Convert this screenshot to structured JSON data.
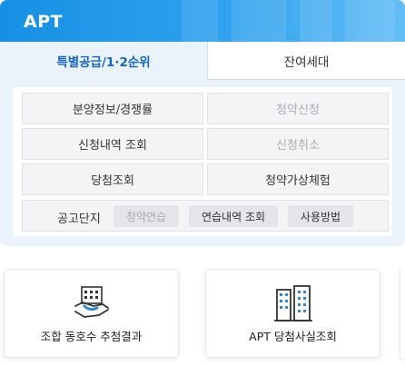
{
  "panel": {
    "title": "APT"
  },
  "tabs": [
    {
      "label": "특별공급/1·2순위",
      "active": true
    },
    {
      "label": "잔여세대",
      "active": false
    }
  ],
  "menu": {
    "rows": [
      {
        "left": {
          "label": "분양정보/경쟁률",
          "enabled": true
        },
        "right": {
          "label": "청약신청",
          "enabled": false
        }
      },
      {
        "left": {
          "label": "신청내역 조회",
          "enabled": true
        },
        "right": {
          "label": "신청취소",
          "enabled": false
        }
      },
      {
        "left": {
          "label": "당첨조회",
          "enabled": true
        },
        "right": {
          "label": "청약가상체험",
          "enabled": true
        }
      }
    ]
  },
  "notice": {
    "label": "공고단지",
    "buttons": [
      {
        "label": "청약연습",
        "enabled": false
      },
      {
        "label": "연습내역 조회",
        "enabled": true
      },
      {
        "label": "사용방법",
        "enabled": true
      }
    ]
  },
  "cards": [
    {
      "label": "조합 동호수 추첨결과",
      "icon": "handshake-building-icon"
    },
    {
      "label": "APT 당첨사실조회",
      "icon": "apartment-buildings-icon"
    }
  ],
  "colors": {
    "header": "#1690e4",
    "active_tab_text": "#1563c4",
    "panel_bg": "#eaf3fc"
  }
}
